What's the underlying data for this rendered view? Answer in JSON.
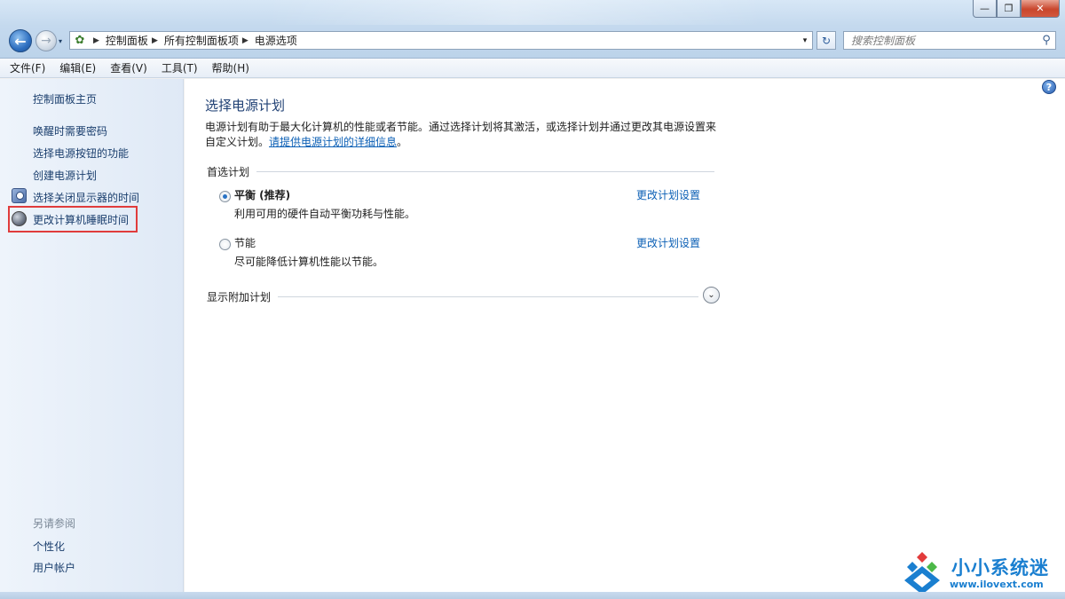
{
  "window": {
    "minimize_glyph": "—",
    "maximize_glyph": "❐",
    "close_glyph": "✕"
  },
  "nav": {
    "back_glyph": "←",
    "forward_glyph": "→",
    "history_glyph": "▾"
  },
  "address": {
    "icon": "control-panel-icon",
    "breadcrumbs": [
      "控制面板",
      "所有控制面板项",
      "电源选项"
    ],
    "separator_glyph": "▶",
    "dropdown_glyph": "▾",
    "refresh_glyph": "↻"
  },
  "search": {
    "placeholder": "搜索控制面板",
    "icon_glyph": "⚲"
  },
  "menu": [
    "文件(F)",
    "编辑(E)",
    "查看(V)",
    "工具(T)",
    "帮助(H)"
  ],
  "sidebar": {
    "home": "控制面板主页",
    "items": [
      "唤醒时需要密码",
      "选择电源按钮的功能",
      "创建电源计划",
      "选择关闭显示器的时间",
      "更改计算机睡眠时间"
    ],
    "see_also_title": "另请参阅",
    "see_also": [
      "个性化",
      "用户帐户"
    ]
  },
  "main": {
    "title": "选择电源计划",
    "intro": "电源计划有助于最大化计算机的性能或者节能。通过选择计划将其激活，或选择计划并通过更改其电源设置来自定义计划。",
    "intro_link": "请提供电源计划的详细信息",
    "intro_end": "。",
    "preferred_heading": "首选计划",
    "plans": [
      {
        "name": "平衡 (推荐)",
        "desc": "利用可用的硬件自动平衡功耗与性能。",
        "link": "更改计划设置",
        "selected": true
      },
      {
        "name": "节能",
        "desc": "尽可能降低计算机性能以节能。",
        "link": "更改计划设置",
        "selected": false
      }
    ],
    "additional_heading": "显示附加计划",
    "expand_glyph": "⌄",
    "help_glyph": "?"
  },
  "watermark": {
    "title": "小小系统迷",
    "url": "www.ilovext.com"
  },
  "colors": {
    "link": "#0b5fb5",
    "title": "#1e3f73",
    "highlight": "#e03c3c",
    "watermark": "#1a7fd0"
  }
}
